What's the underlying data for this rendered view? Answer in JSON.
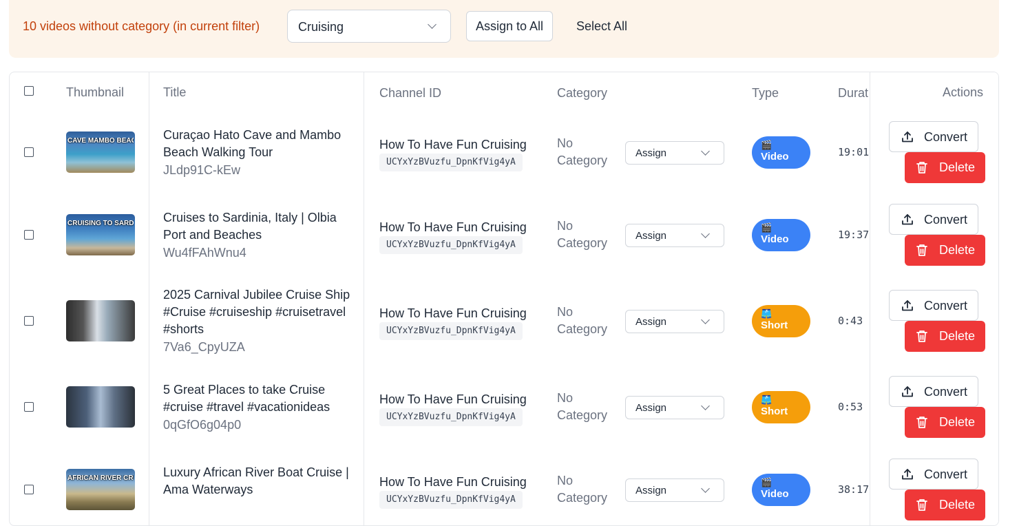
{
  "banner": {
    "message": "10 videos without category (in current filter)",
    "category_select_value": "Cruising",
    "assign_all_label": "Assign to All",
    "select_all_label": "Select All",
    "message_color": "#c2410c",
    "background_color": "#fdf4ea"
  },
  "table": {
    "headers": {
      "thumbnail": "Thumbnail",
      "title": "Title",
      "channel_id": "Channel ID",
      "category": "Category",
      "type": "Type",
      "duration": "Durat",
      "actions": "Actions"
    },
    "rows": [
      {
        "title": "Curaçao Hato Cave and Mambo Beach Walking Tour",
        "video_id": "JLdp91C-kEw",
        "channel_name": "How To Have Fun Cruising",
        "channel_id": "UCYxYzBVuzfu_DpnKfVig4yA",
        "category": "No Category",
        "assign_label": "Assign",
        "type": "Video",
        "type_icon": "🎬",
        "duration": "19:01",
        "convert_label": "Convert",
        "delete_label": "Delete",
        "thumbnail_caption": "CAVE MAMBO BEACH"
      },
      {
        "title": "Cruises to Sardinia, Italy | Olbia Port and Beaches",
        "video_id": "Wu4fFAhWnu4",
        "channel_name": "How To Have Fun Cruising",
        "channel_id": "UCYxYzBVuzfu_DpnKfVig4yA",
        "category": "No Category",
        "assign_label": "Assign",
        "type": "Video",
        "type_icon": "🎬",
        "duration": "19:37",
        "convert_label": "Convert",
        "delete_label": "Delete",
        "thumbnail_caption": "CRUISING TO SARDINIA"
      },
      {
        "title": "2025 Carnival Jubilee Cruise Ship #Cruise #cruiseship #cruisetravel #shorts",
        "video_id": "7Va6_CpyUZA",
        "channel_name": "How To Have Fun Cruising",
        "channel_id": "UCYxYzBVuzfu_DpnKfVig4yA",
        "category": "No Category",
        "assign_label": "Assign",
        "type": "Short",
        "type_icon": "🩳",
        "duration": "0:43",
        "convert_label": "Convert",
        "delete_label": "Delete",
        "thumbnail_caption": ""
      },
      {
        "title": "5 Great Places to take Cruise #cruise #travel #vacationideas",
        "video_id": "0qGfO6g04p0",
        "channel_name": "How To Have Fun Cruising",
        "channel_id": "UCYxYzBVuzfu_DpnKfVig4yA",
        "category": "No Category",
        "assign_label": "Assign",
        "type": "Short",
        "type_icon": "🩳",
        "duration": "0:53",
        "convert_label": "Convert",
        "delete_label": "Delete",
        "thumbnail_caption": ""
      },
      {
        "title": "Luxury African River Boat Cruise | Ama Waterways",
        "video_id": "",
        "channel_name": "How To Have Fun Cruising",
        "channel_id": "UCYxYzBVuzfu_DpnKfVig4yA",
        "category": "No Category",
        "assign_label": "Assign",
        "type": "Video",
        "type_icon": "🎬",
        "duration": "38:17",
        "convert_label": "Convert",
        "delete_label": "Delete",
        "thumbnail_caption": "AFRICAN RIVER CRUISE"
      }
    ]
  },
  "colors": {
    "video_badge": "#3b82f6",
    "short_badge": "#f59e0b",
    "delete_button": "#ef3838"
  }
}
